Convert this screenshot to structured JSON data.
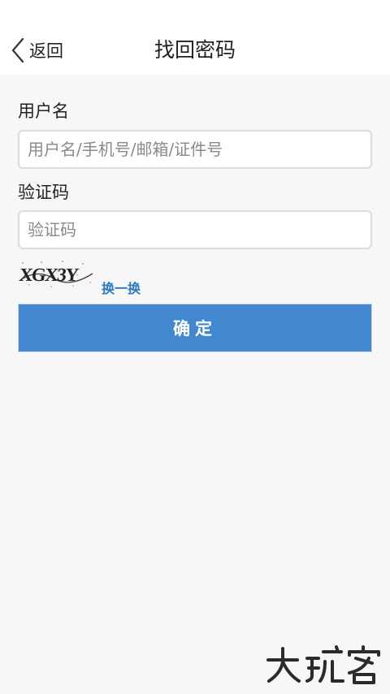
{
  "header": {
    "back_label": "返回",
    "title": "找回密码"
  },
  "form": {
    "username_label": "用户名",
    "username_placeholder": "用户名/手机号/邮箱/证件号",
    "code_label": "验证码",
    "code_placeholder": "验证码",
    "captcha_text": "XGX3Y",
    "refresh_label": "换一换",
    "submit_label": "确定"
  },
  "watermark": {
    "text": "大玩客"
  },
  "colors": {
    "primary": "#4188d1",
    "link": "#2a7ac6",
    "background": "#f7f7f7"
  }
}
